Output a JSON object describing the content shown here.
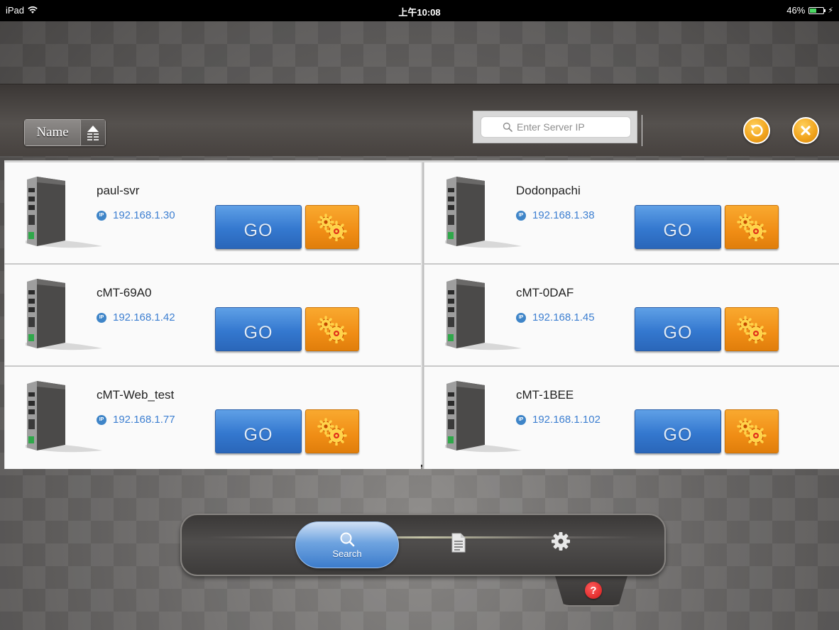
{
  "status_bar": {
    "carrier": "iPad",
    "time": "上午10:08",
    "battery": "46%",
    "battery_level": 0.46
  },
  "header": {
    "sort_label": "Name",
    "search_placeholder": "Enter Server IP"
  },
  "buttons": {
    "go_label": "GO"
  },
  "devices": [
    {
      "name": "paul-svr",
      "ip": "192.168.1.30"
    },
    {
      "name": "Dodonpachi",
      "ip": "192.168.1.38"
    },
    {
      "name": "cMT-69A0",
      "ip": "192.168.1.42"
    },
    {
      "name": "cMT-0DAF",
      "ip": "192.168.1.45"
    },
    {
      "name": "cMT-Web_test",
      "ip": "192.168.1.77"
    },
    {
      "name": "cMT-1BEE",
      "ip": "192.168.1.102"
    }
  ],
  "dock": {
    "search_label": "Search",
    "help_glyph": "?"
  },
  "icons": {
    "sort": "sort-ascending-icon",
    "search": "magnifier-icon",
    "refresh": "refresh-icon",
    "close": "close-icon",
    "ip": "ip-badge-icon",
    "settings": "gears-icon",
    "document": "document-icon",
    "gear": "gear-icon",
    "help": "help-icon"
  },
  "colors": {
    "go_blue": "#3478cf",
    "settings_orange": "#f08d15",
    "ip_text": "#3d7fd1",
    "round_button_orange": "#f0a21b",
    "help_red": "#d41a1a"
  }
}
